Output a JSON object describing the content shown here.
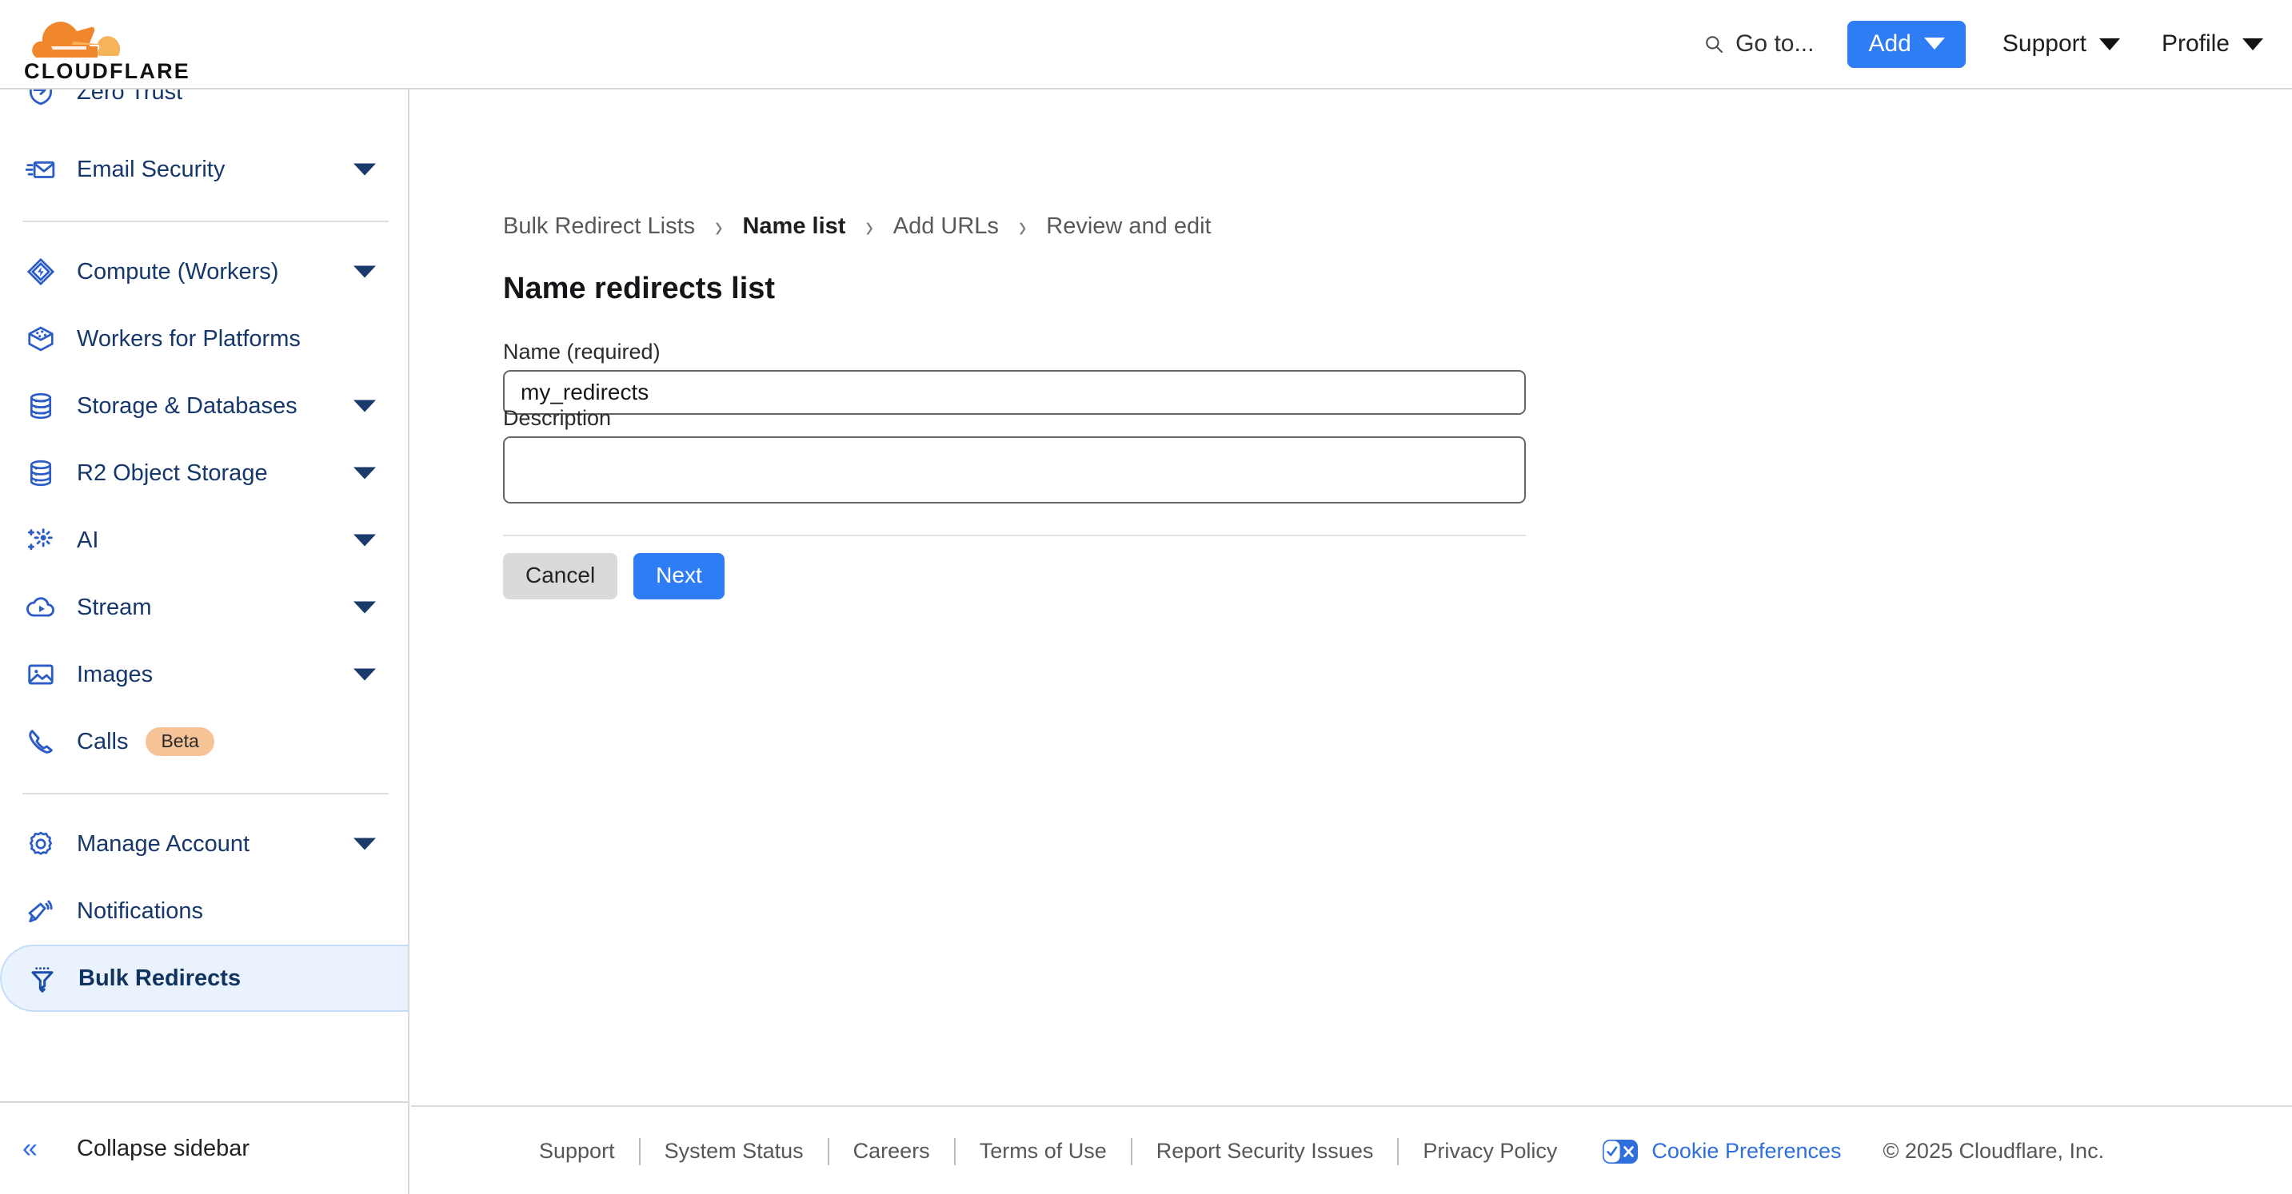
{
  "brand": {
    "name": "CLOUDFLARE"
  },
  "header": {
    "search_label": "Go to...",
    "add_label": "Add",
    "support_label": "Support",
    "profile_label": "Profile"
  },
  "sidebar": {
    "items": [
      {
        "label": "Zero Trust",
        "icon": "shield-arrow-icon",
        "expandable": false,
        "selected": false,
        "badge": ""
      },
      {
        "label": "Email Security",
        "icon": "envelope-icon",
        "expandable": true,
        "selected": false,
        "badge": ""
      },
      {
        "label": "Compute (Workers)",
        "icon": "workers-icon",
        "expandable": true,
        "selected": false,
        "badge": ""
      },
      {
        "label": "Workers for Platforms",
        "icon": "box-icon",
        "expandable": false,
        "selected": false,
        "badge": ""
      },
      {
        "label": "Storage & Databases",
        "icon": "database-list-icon",
        "expandable": true,
        "selected": false,
        "badge": ""
      },
      {
        "label": "R2 Object Storage",
        "icon": "database-icon",
        "expandable": true,
        "selected": false,
        "badge": ""
      },
      {
        "label": "AI",
        "icon": "sparkle-icon",
        "expandable": true,
        "selected": false,
        "badge": ""
      },
      {
        "label": "Stream",
        "icon": "cloud-play-icon",
        "expandable": true,
        "selected": false,
        "badge": ""
      },
      {
        "label": "Images",
        "icon": "image-icon",
        "expandable": true,
        "selected": false,
        "badge": ""
      },
      {
        "label": "Calls",
        "icon": "phone-icon",
        "expandable": false,
        "selected": false,
        "badge": "Beta"
      },
      {
        "label": "Manage Account",
        "icon": "gear-icon",
        "expandable": true,
        "selected": false,
        "badge": ""
      },
      {
        "label": "Notifications",
        "icon": "megaphone-icon",
        "expandable": false,
        "selected": false,
        "badge": ""
      },
      {
        "label": "Bulk Redirects",
        "icon": "funnel-icon",
        "expandable": false,
        "selected": true,
        "badge": ""
      }
    ],
    "collapse_label": "Collapse sidebar"
  },
  "main": {
    "breadcrumb": [
      {
        "label": "Bulk Redirect Lists",
        "current": false
      },
      {
        "label": "Name list",
        "current": true
      },
      {
        "label": "Add URLs",
        "current": false
      },
      {
        "label": "Review and edit",
        "current": false
      }
    ],
    "title": "Name redirects list",
    "name_label": "Name (required)",
    "name_value": "my_redirects",
    "name_placeholder": "",
    "description_label": "Description",
    "description_value": "",
    "description_placeholder": "",
    "cancel_label": "Cancel",
    "next_label": "Next"
  },
  "footer": {
    "links": [
      "Support",
      "System Status",
      "Careers",
      "Terms of Use",
      "Report Security Issues",
      "Privacy Policy"
    ],
    "cookie_label": "Cookie Preferences",
    "copyright": "© 2025 Cloudflare, Inc."
  },
  "colors": {
    "accent_blue": "#2f7df4",
    "brand_orange": "#f1872c",
    "brand_orange_light": "#f6b45a",
    "nav_blue": "#2c5cc5",
    "nav_text": "#15376b",
    "selected_bg": "#eaf2fd",
    "badge_bg": "#f5c396"
  }
}
